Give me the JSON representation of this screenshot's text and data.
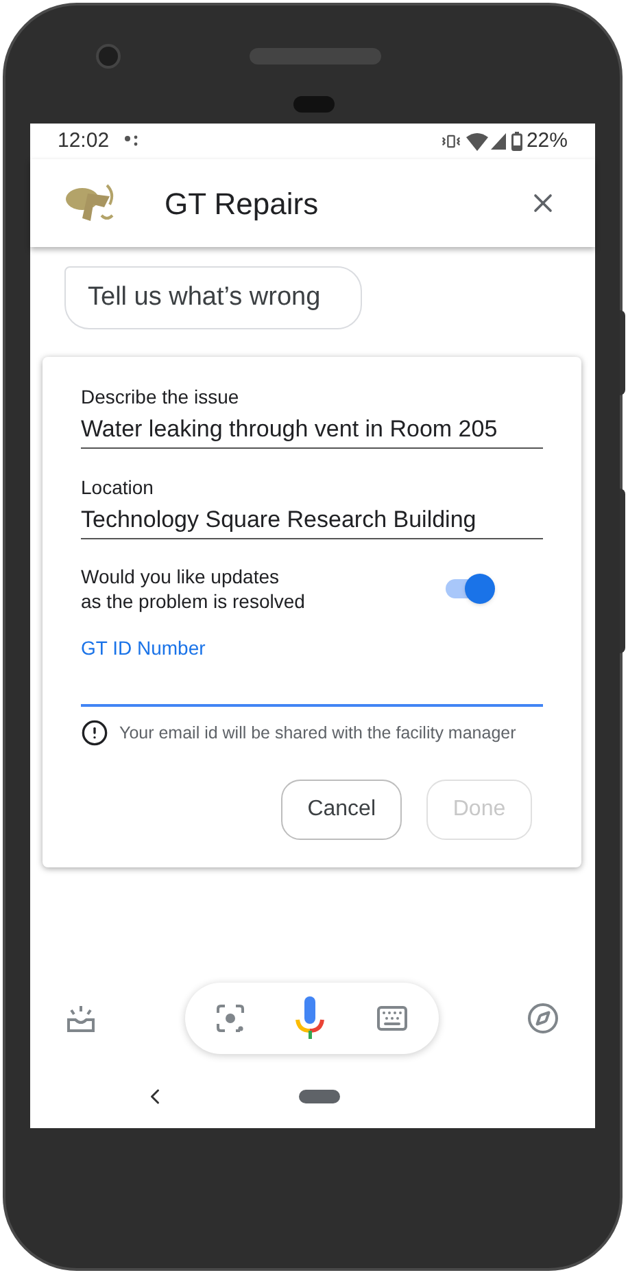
{
  "status_bar": {
    "time": "12:02",
    "battery": "22%"
  },
  "app_bar": {
    "title": "GT Repairs"
  },
  "bubble": {
    "text": "Tell us what’s wrong"
  },
  "form": {
    "fields": [
      {
        "label": "Describe the issue",
        "value": "Water leaking through vent in Room 205",
        "focused": false
      },
      {
        "label": "Location",
        "value": "Technology Square Research Building",
        "focused": false
      }
    ],
    "toggle": {
      "label_lines": [
        "Would you like updates",
        "as the problem is resolved"
      ],
      "on": true
    },
    "id_field": {
      "label": "GT ID Number",
      "focused": true
    },
    "note": "Your email id will be shared with the facility manager",
    "buttons": [
      {
        "label": "Cancel",
        "disabled": false
      },
      {
        "label": "Done",
        "disabled": true
      }
    ]
  }
}
